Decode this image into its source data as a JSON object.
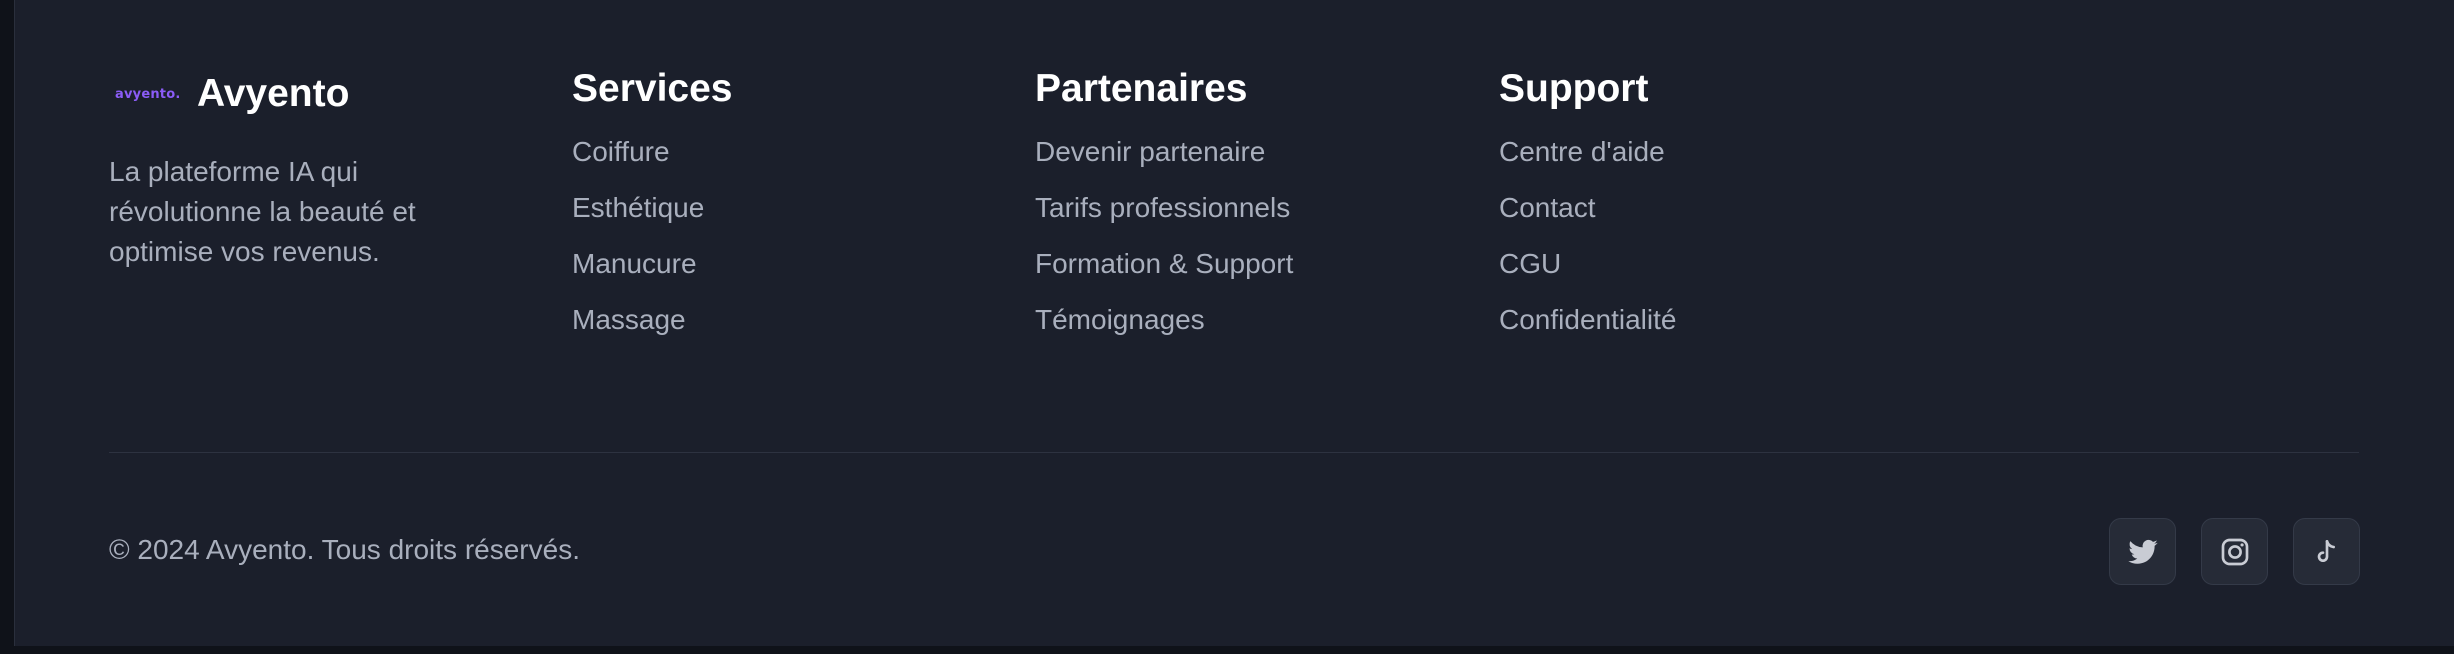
{
  "brand": {
    "logo_text": "avyento.",
    "name": "Avyento",
    "tagline": "La plateforme IA qui révolutionne la beauté et optimise vos revenus.",
    "accent_color": "#8b5cf6"
  },
  "columns": [
    {
      "title": "Services",
      "links": [
        "Coiffure",
        "Esthétique",
        "Manucure",
        "Massage"
      ]
    },
    {
      "title": "Partenaires",
      "links": [
        "Devenir partenaire",
        "Tarifs professionnels",
        "Formation & Support",
        "Témoignages"
      ]
    },
    {
      "title": "Support",
      "links": [
        "Centre d'aide",
        "Contact",
        "CGU",
        "Confidentialité"
      ]
    }
  ],
  "bottom": {
    "copyright": "© 2024 Avyento. Tous droits réservés."
  },
  "socials": [
    {
      "icon": "twitter-icon"
    },
    {
      "icon": "instagram-icon"
    },
    {
      "icon": "tiktok-icon"
    }
  ],
  "colors": {
    "background": "#1b1f2b",
    "heading": "#ffffff",
    "text": "#a9afbd",
    "icon": "#c9ccd4"
  }
}
